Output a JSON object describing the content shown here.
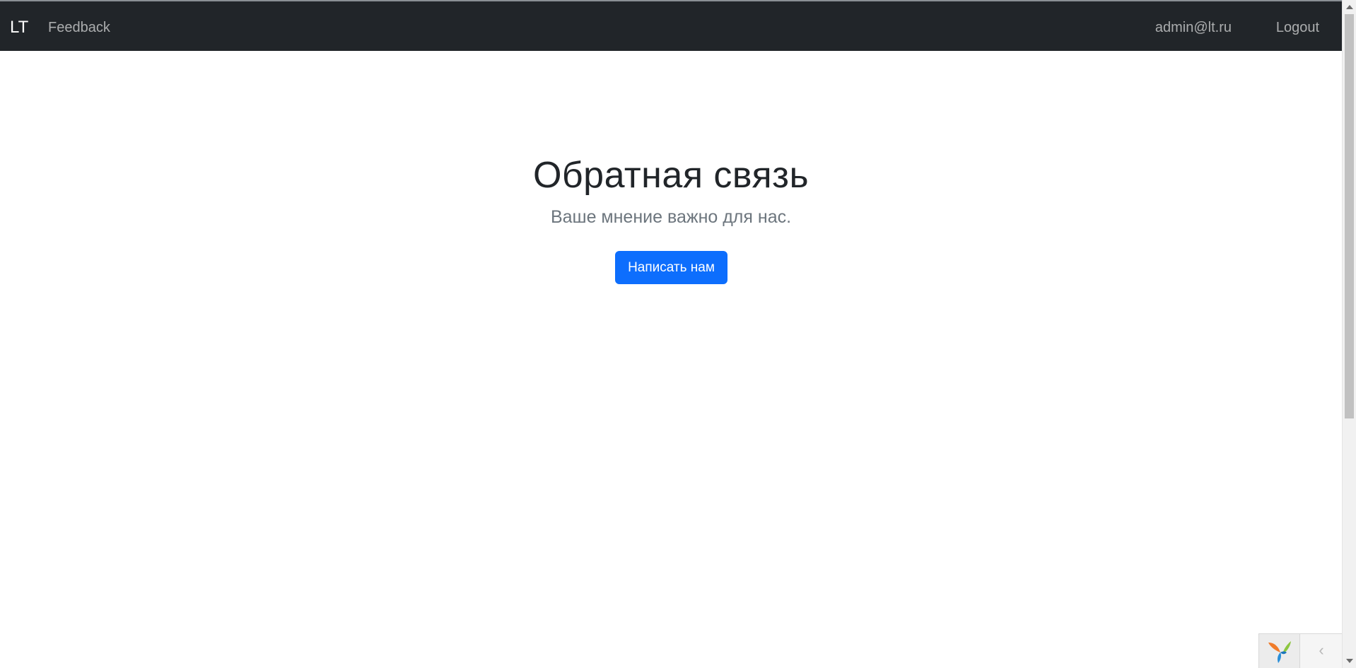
{
  "navbar": {
    "brand": "LT",
    "feedback_link": "Feedback",
    "user_email": "admin@lt.ru",
    "logout_link": "Logout"
  },
  "hero": {
    "title": "Обратная связь",
    "lead": "Ваше мнение важно для нас.",
    "button_label": "Написать нам"
  },
  "debug_toolbar": {
    "logo_icon": "yii-logo-icon",
    "toggle_icon": "chevron-left-icon",
    "toggle_glyph": "‹"
  },
  "colors": {
    "navbar_bg": "#212529",
    "primary": "#0d6efd",
    "muted_text": "#6c757d"
  }
}
